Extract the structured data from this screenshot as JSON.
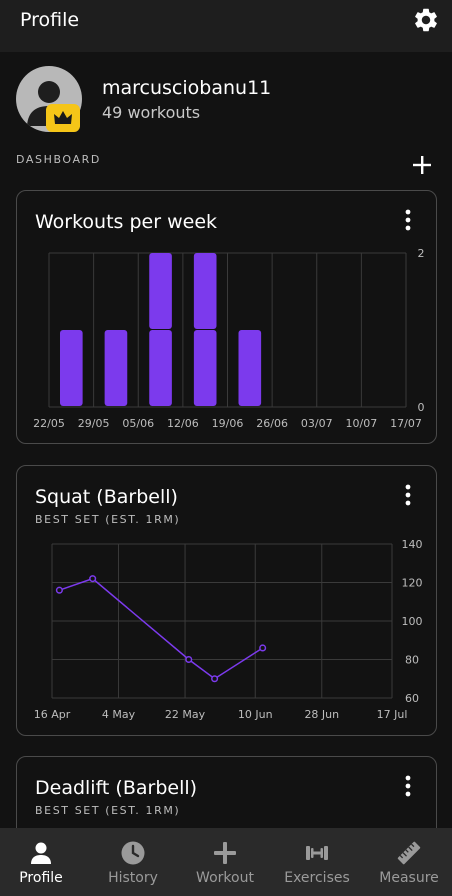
{
  "header": {
    "title": "Profile",
    "settings_icon": "gear-icon"
  },
  "profile": {
    "username": "marcusciobanu11",
    "workouts": "49 workouts",
    "avatar_icon": "person-icon",
    "badge_icon": "crown-icon",
    "badge_color": "#f5c518"
  },
  "dashboard": {
    "section_label": "DASHBOARD",
    "add_icon": "plus-icon"
  },
  "cards": [
    {
      "title": "Workouts per week",
      "subtitle": ""
    },
    {
      "title": "Squat (Barbell)",
      "subtitle": "BEST SET (EST. 1RM)"
    },
    {
      "title": "Deadlift (Barbell)",
      "subtitle": "BEST SET (EST. 1RM)"
    }
  ],
  "chart_data": [
    {
      "type": "bar",
      "title": "Workouts per week",
      "categories": [
        "22/05",
        "29/05",
        "05/06",
        "12/06",
        "19/06",
        "26/06",
        "03/07",
        "10/07",
        "17/07"
      ],
      "values": [
        1,
        1,
        2,
        2,
        1,
        0,
        0,
        0
      ],
      "y_ticks": [
        "2",
        "0"
      ],
      "ylim": [
        0,
        2
      ],
      "color": "#7c3aed",
      "grid": true
    },
    {
      "type": "line",
      "title": "Squat (Barbell)",
      "subtitle": "BEST SET (EST. 1RM)",
      "x_ticks": [
        "16 Apr",
        "4 May",
        "22 May",
        "10 Jun",
        "28 Jun",
        "17 Jul"
      ],
      "y_ticks": [
        "140",
        "120",
        "100",
        "80",
        "60"
      ],
      "ylim": [
        60,
        140
      ],
      "points": [
        {
          "x": "18 Apr",
          "y": 116
        },
        {
          "x": "27 Apr",
          "y": 122
        },
        {
          "x": "23 May",
          "y": 80
        },
        {
          "x": "30 May",
          "y": 70
        },
        {
          "x": "12 Jun",
          "y": 86
        }
      ],
      "color": "#7c3aed",
      "grid": true
    }
  ],
  "navbar": {
    "items": [
      {
        "label": "Profile",
        "icon": "person-icon",
        "active": true
      },
      {
        "label": "History",
        "icon": "clock-icon",
        "active": false
      },
      {
        "label": "Workout",
        "icon": "plus-icon",
        "active": false
      },
      {
        "label": "Exercises",
        "icon": "dumbbell-icon",
        "active": false
      },
      {
        "label": "Measure",
        "icon": "ruler-icon",
        "active": false
      }
    ]
  }
}
